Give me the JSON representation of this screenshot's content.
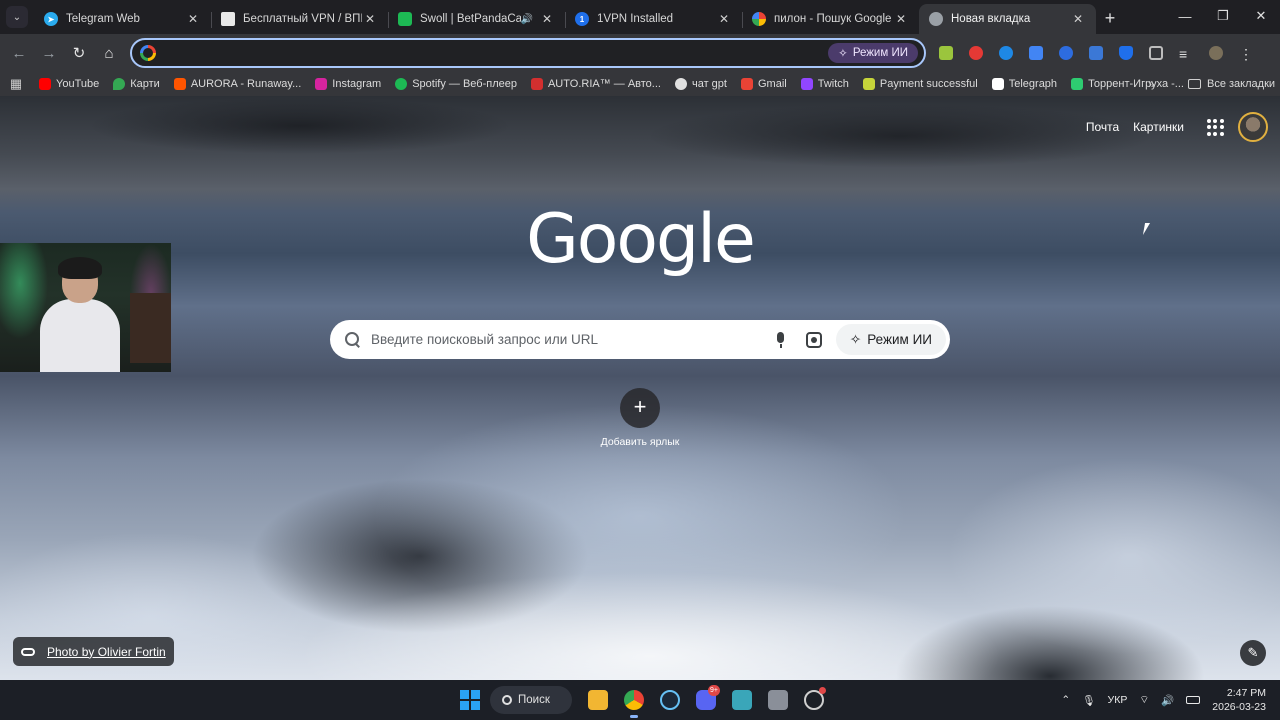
{
  "tabs": [
    {
      "title": "Telegram Web",
      "favicon_color": "#2aabee",
      "audio": false
    },
    {
      "title": "Бесплатный VPN / ВПН - Б",
      "favicon_color": "#e8e8e8",
      "audio": false
    },
    {
      "title": "Swoll | BetPandaCasino",
      "favicon_color": "#1db954",
      "audio": true
    },
    {
      "title": "1VPN Installed",
      "favicon_color": "#1f6feb",
      "audio": false
    },
    {
      "title": "пилон - Пошук Google",
      "favicon_color": "#ffffff",
      "audio": false
    },
    {
      "title": "Новая вкладка",
      "favicon_color": "#9aa0a6",
      "audio": false,
      "active": true
    }
  ],
  "window_controls": {
    "minimize": "—",
    "restore": "❐",
    "close": "✕"
  },
  "toolbar": {
    "back": "←",
    "forward": "→",
    "reload": "↻",
    "home": "⌂",
    "omnibox_value": "",
    "ai_mode_label": "Режим ИИ"
  },
  "extensions": [
    {
      "name": "ext-green-icon",
      "color": "#9bc53d"
    },
    {
      "name": "ext-red-shield-icon",
      "color": "#e53935"
    },
    {
      "name": "ext-shazam-icon",
      "color": "#1e88e5"
    },
    {
      "name": "ext-translate-icon",
      "color": "#4285f4"
    },
    {
      "name": "ext-meta-icon",
      "color": "#2d6cdf"
    },
    {
      "name": "ext-office-icon",
      "color": "#3b78d6"
    },
    {
      "name": "ext-vpn-shield-icon",
      "color": "#1f6feb"
    },
    {
      "name": "extensions-puzzle-icon",
      "color": "#bdbdbd"
    },
    {
      "name": "media-control-icon",
      "color": "#bdbdbd"
    },
    {
      "name": "profile-avatar-icon",
      "color": "#7a6f5a"
    }
  ],
  "bookmarks": [
    {
      "label": "YouTube",
      "color": "#ff0000"
    },
    {
      "label": "Карти",
      "color": "#34a853"
    },
    {
      "label": "AURORA - Runaway...",
      "color": "#ff5500"
    },
    {
      "label": "Instagram",
      "color": "#d6249f"
    },
    {
      "label": "Spotify — Веб-плеер",
      "color": "#1db954"
    },
    {
      "label": "AUTO.RIA™ — Авто...",
      "color": "#d32f2f"
    },
    {
      "label": "чат gpt",
      "color": "#e0e0e0"
    },
    {
      "label": "Gmail",
      "color": "#ea4335"
    },
    {
      "label": "Twitch",
      "color": "#9146ff"
    },
    {
      "label": "Payment successful",
      "color": "#c6d43a"
    },
    {
      "label": "Telegraph",
      "color": "#ffffff"
    },
    {
      "label": "Торрент-Игруха -...",
      "color": "#2ecc71"
    }
  ],
  "bookmarks_more": "»",
  "all_bookmarks_label": "Все закладки",
  "newtab": {
    "links": {
      "mail": "Почта",
      "images": "Картинки"
    },
    "logo": "Google",
    "search_placeholder": "Введите поисковый запрос или URL",
    "ai_mode_label": "Режим ИИ",
    "add_shortcut_label": "Добавить ярлык",
    "add_shortcut_glyph": "+",
    "photo_credit": "Photo by Olivier Fortin",
    "edit_glyph": "✎"
  },
  "taskbar": {
    "search_label": "Поиск",
    "discord_badge": "9+",
    "language": "УКР",
    "time": "2:47 PM",
    "date": "2026-03-23",
    "tray_up": "⌃",
    "tray_mic": "🎙",
    "tray_wifi": "⌔",
    "tray_volume": "🔊"
  }
}
